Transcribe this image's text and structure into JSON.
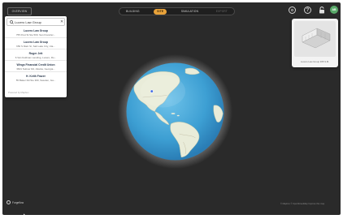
{
  "toolbar": {
    "back_label": "OVERVIEW",
    "modes": [
      {
        "label": "BUILDING",
        "state": "normal"
      },
      {
        "label": "SITE",
        "state": "active"
      },
      {
        "label": "SIMULATION",
        "state": "normal"
      },
      {
        "label": "EXPORT",
        "state": "disabled"
      }
    ],
    "avatar_initials": "AB",
    "accent_color": "#e8a23a"
  },
  "search": {
    "value": "Lucero Law Group",
    "results": [
      {
        "name": "Lucero Law Group",
        "address": "755 Post St Ste 500, San Francisc..."
      },
      {
        "name": "Lucero Law Group",
        "address": "650 S Main St, Salt Lake City, Uta..."
      },
      {
        "name": "Roger Jett",
        "address": "6 Van Feldman Landing, Lucero, Ro..."
      },
      {
        "name": "Wings Financial Credit Union",
        "address": "3601 Suttner Rd, Atlanta, Georgia..."
      },
      {
        "name": "H. Keith Frazer",
        "address": "55 Baker Rd Ste 300, Sweden, Ga..."
      }
    ],
    "powered_by": "Powered by Mapbox"
  },
  "preview": {
    "label": "Lucero Law Group 365 S.M."
  },
  "footer": {
    "brand": "Forgeflow",
    "attribution": "© Mapbox © OpenStreetMap Improve this map"
  }
}
